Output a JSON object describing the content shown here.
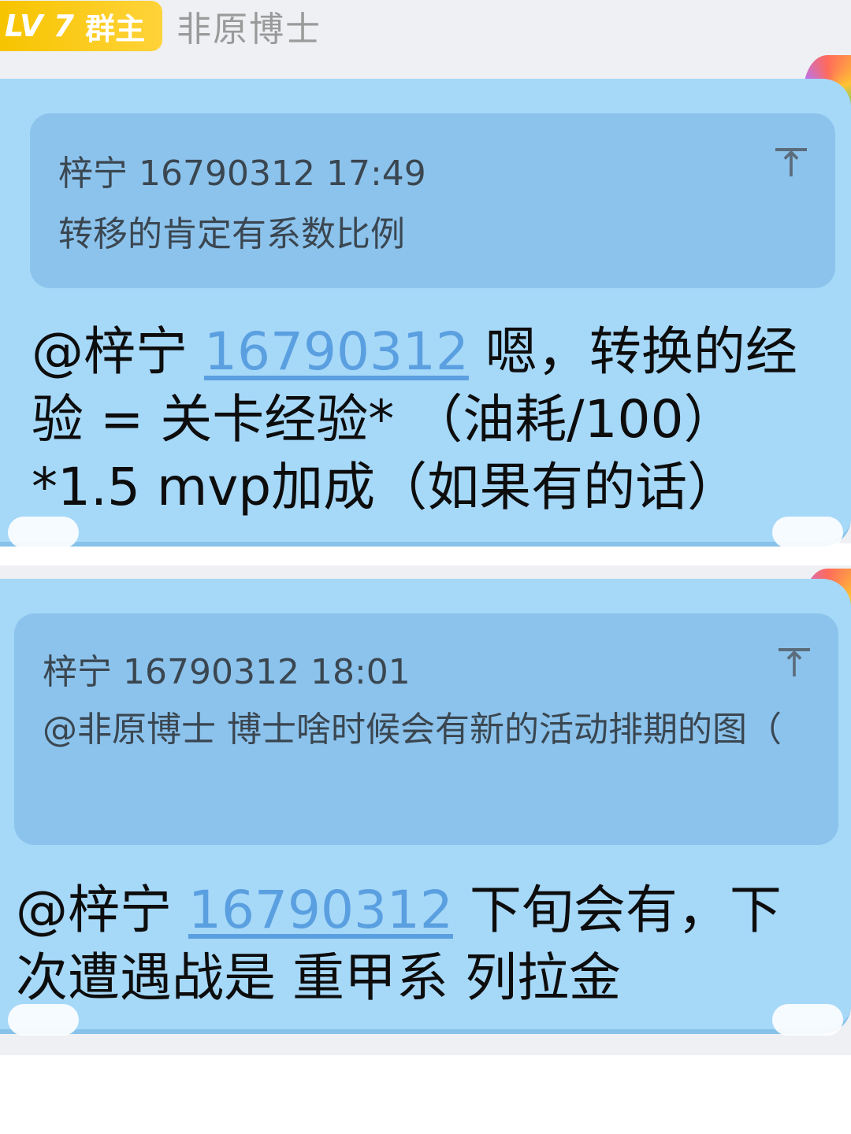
{
  "header": {
    "level_label": "LV 7",
    "role_label": "群主",
    "username": "非原博士"
  },
  "messages": [
    {
      "quote": {
        "author": "梓宁",
        "author_id": "16790312",
        "time": "17:49",
        "text": "转移的肯定有系数比例",
        "pin_icon": "pin-to-top-icon"
      },
      "mention_prefix": "@梓宁 ",
      "mention_link": "16790312",
      "reply_text": " 嗯，转换的经验 = 关卡经验* （油耗/100） *1.5 mvp加成（如果有的话）"
    },
    {
      "quote": {
        "author": "梓宁",
        "author_id": "16790312",
        "time": "18:01",
        "text": "@非原博士 博士啥时候会有新的活动排期的图（",
        "pin_icon": "pin-to-top-icon"
      },
      "mention_prefix": "@梓宁 ",
      "mention_link": "16790312",
      "reply_text": " 下旬会有，下次遭遇战是 重甲系 列拉金"
    }
  ],
  "colors": {
    "bubble": "#a6d8f8",
    "quote": "#8cc3ec",
    "badge": "#f7c400",
    "link": "#5a9fe0"
  }
}
